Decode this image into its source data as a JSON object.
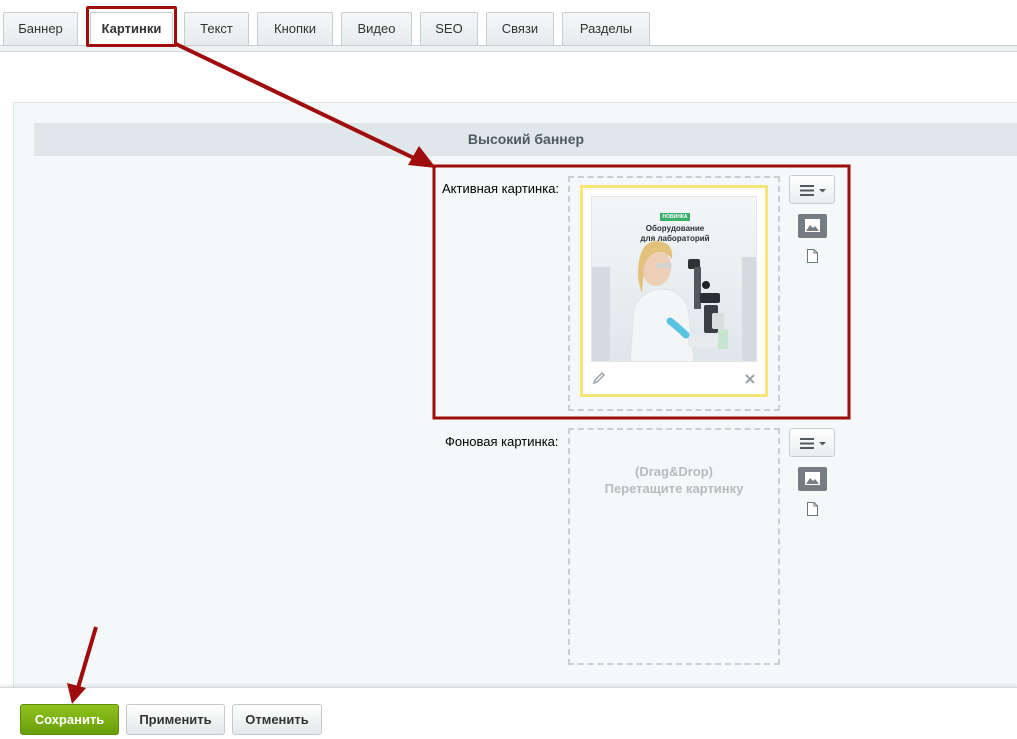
{
  "tabs": [
    {
      "label": "Баннер"
    },
    {
      "label": "Картинки"
    },
    {
      "label": "Текст"
    },
    {
      "label": "Кнопки"
    },
    {
      "label": "Видео"
    },
    {
      "label": "SEO"
    },
    {
      "label": "Связи"
    },
    {
      "label": "Разделы"
    }
  ],
  "active_tab": "Картинки",
  "section": {
    "title": "Высокий баннер"
  },
  "fields": {
    "active_image": {
      "label": "Активная картинка:",
      "preview": {
        "badge": "НОВИНКА",
        "line1": "Оборудование",
        "line2": "для лабораторий"
      }
    },
    "background_image": {
      "label": "Фоновая картинка:",
      "drop_line1": "(Drag&Drop)",
      "drop_line2": "Перетащите картинку"
    }
  },
  "footer": {
    "save_label": "Сохранить",
    "apply_label": "Применить",
    "cancel_label": "Отменить"
  },
  "colors": {
    "accent_red": "#a00d0d",
    "save_green": "#7cb014",
    "card_border": "#f6e57a",
    "panel_bg": "#f5f8f9"
  },
  "icons": [
    "menu-icon",
    "chevron-down-icon",
    "image-icon",
    "file-icon",
    "pencil-icon",
    "close-icon"
  ]
}
